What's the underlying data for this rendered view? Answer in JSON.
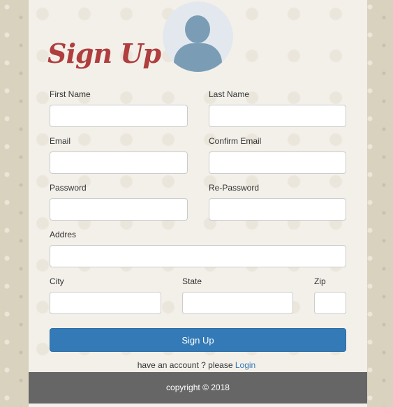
{
  "title": "Sign Up",
  "fields": {
    "first_name": {
      "label": "First Name",
      "value": ""
    },
    "last_name": {
      "label": "Last Name",
      "value": ""
    },
    "email": {
      "label": "Email",
      "value": ""
    },
    "confirm_email": {
      "label": "Confirm Email",
      "value": ""
    },
    "password": {
      "label": "Password",
      "value": ""
    },
    "re_password": {
      "label": "Re-Password",
      "value": ""
    },
    "address": {
      "label": "Addres",
      "value": ""
    },
    "city": {
      "label": "City",
      "value": ""
    },
    "state": {
      "label": "State",
      "value": ""
    },
    "zip": {
      "label": "Zip",
      "value": ""
    }
  },
  "submit_label": "Sign Up",
  "login_prompt": "have an account ? please ",
  "login_link": "Login",
  "footer": "copyright © 2018",
  "colors": {
    "accent": "#337ab7",
    "title": "#b03e3e",
    "footer": "#666666"
  }
}
